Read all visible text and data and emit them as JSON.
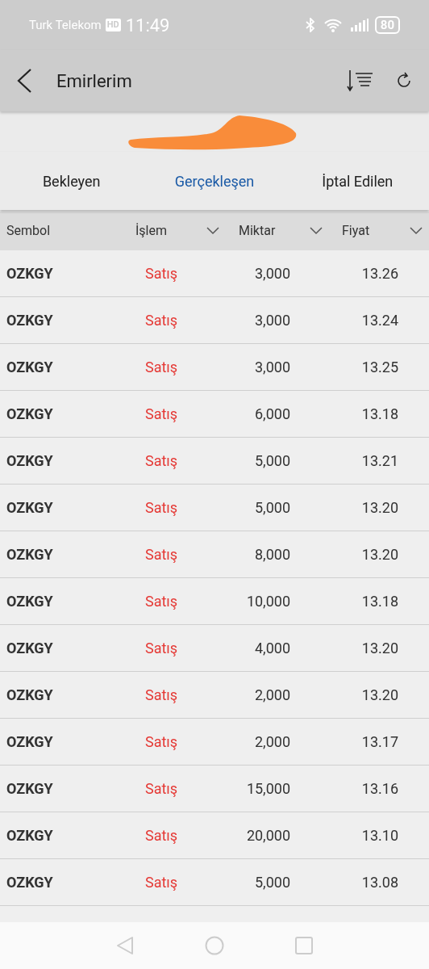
{
  "status_bar": {
    "carrier": "Turk Telekom",
    "hd": "HD",
    "time": "11:49",
    "battery": "80"
  },
  "header": {
    "title": "Emirlerim"
  },
  "tabs": [
    {
      "label": "Bekleyen",
      "selected": false
    },
    {
      "label": "Gerçekleşen",
      "selected": true
    },
    {
      "label": "İptal Edilen",
      "selected": false
    }
  ],
  "table": {
    "columns": [
      {
        "label": "Sembol",
        "sortable": false
      },
      {
        "label": "İşlem",
        "sortable": true
      },
      {
        "label": "Miktar",
        "sortable": true
      },
      {
        "label": "Fiyat",
        "sortable": true
      }
    ],
    "rows": [
      {
        "symbol": "OZKGY",
        "side": "Satış",
        "kind": "sell",
        "quantity": "3,000",
        "price": "13.26"
      },
      {
        "symbol": "OZKGY",
        "side": "Satış",
        "kind": "sell",
        "quantity": "3,000",
        "price": "13.24"
      },
      {
        "symbol": "OZKGY",
        "side": "Satış",
        "kind": "sell",
        "quantity": "3,000",
        "price": "13.25"
      },
      {
        "symbol": "OZKGY",
        "side": "Satış",
        "kind": "sell",
        "quantity": "6,000",
        "price": "13.18"
      },
      {
        "symbol": "OZKGY",
        "side": "Satış",
        "kind": "sell",
        "quantity": "5,000",
        "price": "13.21"
      },
      {
        "symbol": "OZKGY",
        "side": "Satış",
        "kind": "sell",
        "quantity": "5,000",
        "price": "13.20"
      },
      {
        "symbol": "OZKGY",
        "side": "Satış",
        "kind": "sell",
        "quantity": "8,000",
        "price": "13.20"
      },
      {
        "symbol": "OZKGY",
        "side": "Satış",
        "kind": "sell",
        "quantity": "10,000",
        "price": "13.18"
      },
      {
        "symbol": "OZKGY",
        "side": "Satış",
        "kind": "sell",
        "quantity": "4,000",
        "price": "13.20"
      },
      {
        "symbol": "OZKGY",
        "side": "Satış",
        "kind": "sell",
        "quantity": "2,000",
        "price": "13.20"
      },
      {
        "symbol": "OZKGY",
        "side": "Satış",
        "kind": "sell",
        "quantity": "2,000",
        "price": "13.17"
      },
      {
        "symbol": "OZKGY",
        "side": "Satış",
        "kind": "sell",
        "quantity": "15,000",
        "price": "13.16"
      },
      {
        "symbol": "OZKGY",
        "side": "Satış",
        "kind": "sell",
        "quantity": "20,000",
        "price": "13.10"
      },
      {
        "symbol": "OZKGY",
        "side": "Satış",
        "kind": "sell",
        "quantity": "5,000",
        "price": "13.08"
      }
    ]
  }
}
